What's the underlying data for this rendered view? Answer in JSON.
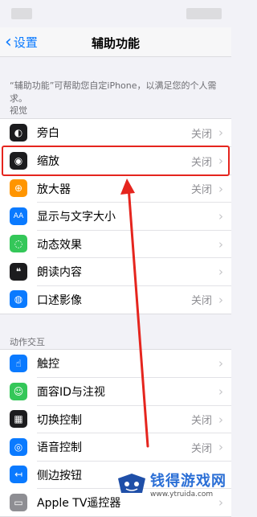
{
  "nav": {
    "back_label": "设置",
    "title": "辅助功能"
  },
  "intro_text": "“辅助功能”可帮助您自定iPhone，以满足您的个人需求。",
  "sections": {
    "vision_header": "视觉",
    "interaction_header": "动作交互"
  },
  "vision_items": [
    {
      "label": "旁白",
      "value": "关闭",
      "icon": "voiceover-icon",
      "color": "#1c1c1e"
    },
    {
      "label": "缩放",
      "value": "关闭",
      "icon": "zoom-icon",
      "color": "#1c1c1e"
    },
    {
      "label": "放大器",
      "value": "关闭",
      "icon": "magnifier-icon",
      "color": "#ff9500"
    },
    {
      "label": "显示与文字大小",
      "value": "",
      "icon": "text-size-icon",
      "color": "#0a7aff"
    },
    {
      "label": "动态效果",
      "value": "",
      "icon": "motion-icon",
      "color": "#34c759"
    },
    {
      "label": "朗读内容",
      "value": "",
      "icon": "speech-icon",
      "color": "#1c1c1e"
    },
    {
      "label": "口述影像",
      "value": "关闭",
      "icon": "audio-description-icon",
      "color": "#0a7aff"
    }
  ],
  "interaction_items": [
    {
      "label": "触控",
      "value": "",
      "icon": "touch-icon",
      "color": "#0a7aff"
    },
    {
      "label": "面容ID与注视",
      "value": "",
      "icon": "faceid-icon",
      "color": "#34c759"
    },
    {
      "label": "切换控制",
      "value": "关闭",
      "icon": "switch-control-icon",
      "color": "#1c1c1e"
    },
    {
      "label": "语音控制",
      "value": "关闭",
      "icon": "voice-control-icon",
      "color": "#0a7aff"
    },
    {
      "label": "侧边按钮",
      "value": "",
      "icon": "side-button-icon",
      "color": "#0a7aff"
    },
    {
      "label": "Apple TV遥控器",
      "value": "",
      "icon": "remote-icon",
      "color": "#8e8e93"
    }
  ],
  "watermark": {
    "big": "钱得游戏网",
    "small": "www.ytruida.com"
  },
  "colors": {
    "accent": "#0a7aff",
    "highlight": "#e5251e"
  }
}
